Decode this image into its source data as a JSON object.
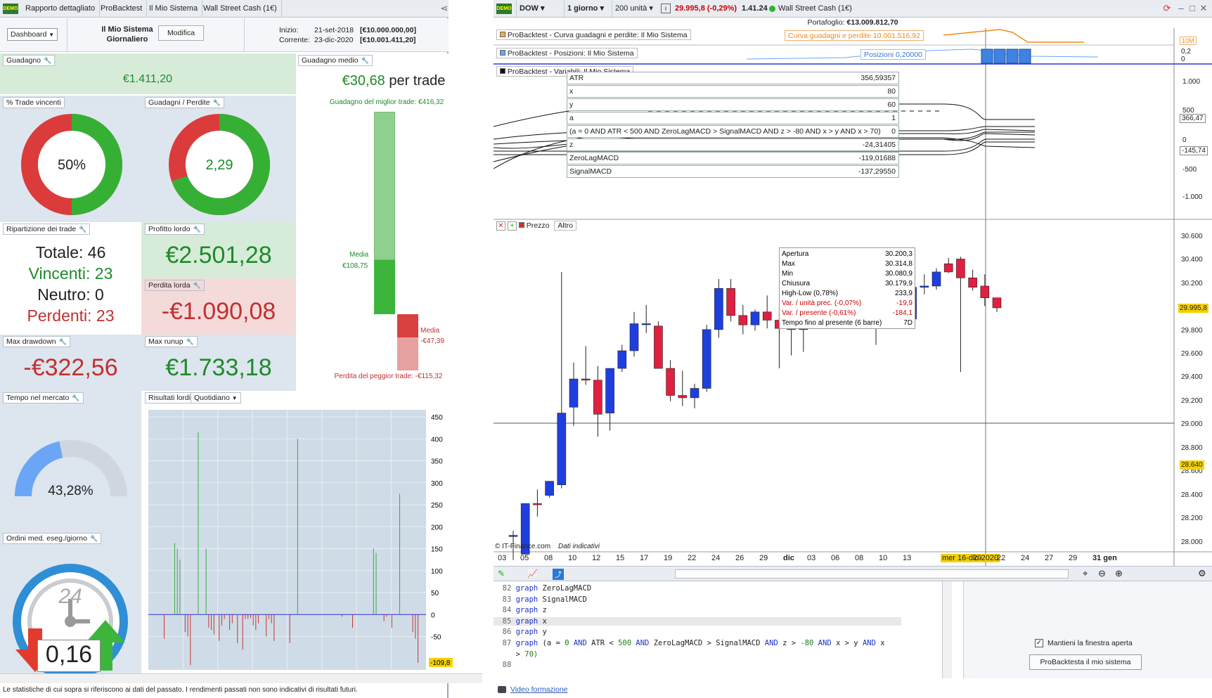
{
  "left": {
    "tabs": [
      "Rapporto dettagliato",
      "ProBacktest",
      "Il Mio Sistema",
      "Wall Street Cash (1€)"
    ],
    "dashboard_label": "Dashboard",
    "system_name": "Il Mio Sistema",
    "system_period": "Giornaliero",
    "modify_label": "Modifica",
    "start_label": "Inizio:",
    "start_date": "21-set-2018",
    "start_value": "[€10.000.000,00]",
    "current_label": "Corrente:",
    "current_date": "23-dic-2020",
    "current_value": "[€10.001.411,20]",
    "gain": {
      "title": "Guadagno",
      "value": "€1.411,20"
    },
    "avg_gain": {
      "title": "Guadagno medio",
      "value": "€30,68",
      "suffix": "per trade",
      "best": "Guadagno del miglior trade: €416,32",
      "worst": "Perdita del peggior trade: -€115,32",
      "media_pos": "Media",
      "media_pos_val": "€108,75",
      "media_neg": "Media",
      "media_neg_val": "-€47,39"
    },
    "win_pct": {
      "title": "% Trade vincenti",
      "value": "50%",
      "fraction": 0.5
    },
    "gain_loss": {
      "title": "Guadagni / Perdite",
      "value": "2,29",
      "fraction": 0.696
    },
    "breakdown": {
      "title": "Ripartizione dei trade",
      "total": "Totale: 46",
      "winners": "Vincenti: 23",
      "neutral": "Neutro: 0",
      "losers": "Perdenti: 23"
    },
    "gross_profit": {
      "title": "Profitto lordo",
      "value": "€2.501,28"
    },
    "gross_loss": {
      "title": "Perdita lorda",
      "value": "-€1.090,08"
    },
    "max_drawdown": {
      "title": "Max drawdown",
      "value": "-€322,56"
    },
    "max_runup": {
      "title": "Max runup",
      "value": "€1.733,18"
    },
    "time_market": {
      "title": "Tempo nel mercato",
      "value": "43,28%",
      "fraction": 0.4328
    },
    "gross_results": {
      "title": "Risultati lordi",
      "period": "Quotidiano"
    },
    "orders": {
      "title": "Ordini med. eseg./giorno",
      "value": "0,16",
      "clock": "24"
    },
    "footer": "Le statistiche di cui sopra si riferiscono ai dati del passato. I rendimenti passati non sono indicativi di risultati futuri."
  },
  "right": {
    "symbol": "DOW",
    "timeframe": "1 giorno",
    "units": "200 unità",
    "price_change": "29.995,8 (-0,29%)",
    "spread": "1.41.24",
    "instrument": "Wall Street Cash (1€)",
    "portfolio_label": "Portafoglio:",
    "portfolio_value": "€13.009.812,70",
    "equity_title": "ProBacktest - Curva guadagni e perdite: Il Mio Sistema",
    "equity_tag": "Curva guadagni e perdite   10.001.516,92",
    "equity_scale": "10M",
    "pos_title": "ProBacktest - Posizioni: Il Mio Sistema",
    "pos_tag": "Posizioni   0,20000",
    "pos_scale_top": "0,2",
    "pos_scale_bot": "0",
    "var_title": "ProBacktest - Variabili: Il Mio Sistema",
    "variables": [
      {
        "name": "ATR",
        "value": "356,59357"
      },
      {
        "name": "x",
        "value": "80"
      },
      {
        "name": "y",
        "value": "60"
      },
      {
        "name": "a",
        "value": "1"
      },
      {
        "name": "(a = 0 AND ATR < 500 AND ZeroLagMACD > SignalMACD AND z > -80 AND x > y AND x > 70)",
        "value": "0"
      },
      {
        "name": "z",
        "value": "-24,31405"
      },
      {
        "name": "ZeroLagMACD",
        "value": "-119,01688"
      },
      {
        "name": "SignalMACD",
        "value": "-137,29550"
      }
    ],
    "var_axis": [
      "1.000",
      "500",
      "0",
      "-500",
      "-1.000"
    ],
    "var_tags": [
      "366,47",
      "-145,74"
    ],
    "price_title": "Prezzo",
    "price_other": "Altro",
    "tooltip": [
      {
        "k": "Apertura",
        "v": "30.200,3",
        "c": "#000"
      },
      {
        "k": "Max",
        "v": "30.314,8",
        "c": "#000"
      },
      {
        "k": "Min",
        "v": "30.080,9",
        "c": "#000"
      },
      {
        "k": "Chiusura",
        "v": "30.179,9",
        "c": "#000"
      },
      {
        "k": "High-Low (0,78%)",
        "v": "233,9",
        "c": "#000"
      },
      {
        "k": "Var. / unità prec. (-0,07%)",
        "v": "-19,9",
        "c": "#c00"
      },
      {
        "k": "Var. / presente (-0,61%)",
        "v": "-184,1",
        "c": "#c00"
      },
      {
        "k": "Tempo fino al presente (6 barre)",
        "v": "7D",
        "c": "#000"
      }
    ],
    "price_axis": [
      "30.600",
      "30.400",
      "30.200",
      "30.000",
      "29.800",
      "29.600",
      "29.400",
      "29.200",
      "29.000",
      "28.800",
      "28.600",
      "28.400",
      "28.200",
      "28.000"
    ],
    "last_price": "29.995,8",
    "cursor_price": "28.640",
    "x_labels": [
      "03",
      "05",
      "08",
      "10",
      "12",
      "15",
      "17",
      "19",
      "22",
      "24",
      "26",
      "29",
      "dic",
      "03",
      "06",
      "08",
      "10",
      "13",
      "mer 16-dic-2020",
      "20",
      "22",
      "24",
      "27",
      "29",
      "31 gen"
    ],
    "copyright": "© IT-Finance.com",
    "indicative": "Dati indicativi",
    "code_lines": [
      {
        "n": "82",
        "t": "graph ZeroLagMACD"
      },
      {
        "n": "83",
        "t": "graph SignalMACD"
      },
      {
        "n": "84",
        "t": "graph z"
      },
      {
        "n": "85",
        "t": "graph x"
      },
      {
        "n": "86",
        "t": "graph y"
      },
      {
        "n": "87",
        "t": "graph (a = 0 AND ATR < 500 AND ZeroLagMACD > SignalMACD AND z > -80 AND x > y AND x"
      },
      {
        "n": "",
        "t": "> 70)"
      },
      {
        "n": "88",
        "t": ""
      }
    ],
    "keep_open": "Mantieni la finestra aperta",
    "run_button": "ProBacktesta il mio sistema",
    "video_link": "Video formazione"
  },
  "chart_data": {
    "type": "bar",
    "title": "Risultati lordi",
    "ylim": [
      -110,
      450
    ],
    "ticks": [
      "450",
      "400",
      "350",
      "300",
      "250",
      "200",
      "150",
      "100",
      "50",
      "0",
      "-50"
    ],
    "last_tag": "-109,8",
    "values": [
      0,
      0,
      0,
      0,
      0,
      -55,
      0,
      0,
      0,
      163,
      150,
      125,
      0,
      -40,
      -50,
      -115,
      0,
      0,
      415,
      0,
      0,
      150,
      -30,
      -35,
      -45,
      0,
      -60,
      -25,
      -10,
      0,
      -35,
      -20,
      0,
      -65,
      0,
      -80,
      -10,
      -10,
      -8,
      -25,
      -35,
      -20,
      0,
      0,
      -50,
      -10,
      -20,
      -60,
      0,
      0,
      0,
      0,
      0,
      -65,
      0,
      0,
      400,
      0,
      0,
      0,
      0,
      0,
      0,
      0,
      0,
      0,
      0,
      0,
      0,
      0,
      0,
      0,
      0,
      -5,
      0,
      0,
      0,
      -30,
      0,
      0,
      0,
      0,
      0,
      0,
      0,
      150,
      140,
      0,
      0,
      -15,
      -5,
      0,
      -30,
      0,
      0,
      275,
      0,
      0,
      0,
      0,
      -40,
      -55,
      -110,
      0
    ]
  },
  "candles": [
    {
      "o": 28050,
      "h": 28100,
      "l": 27850,
      "c": 28060
    },
    {
      "o": 27900,
      "h": 28330,
      "l": 27900,
      "c": 28330
    },
    {
      "o": 28330,
      "h": 28450,
      "l": 28220,
      "c": 28320
    },
    {
      "o": 28400,
      "h": 28520,
      "l": 28380,
      "c": 28520
    },
    {
      "o": 28490,
      "h": 30300,
      "l": 28460,
      "c": 29100
    },
    {
      "o": 29150,
      "h": 29530,
      "l": 28990,
      "c": 29390
    },
    {
      "o": 29390,
      "h": 29670,
      "l": 29340,
      "c": 29380
    },
    {
      "o": 29380,
      "h": 29500,
      "l": 28900,
      "c": 29090
    },
    {
      "o": 29100,
      "h": 29480,
      "l": 28950,
      "c": 29480
    },
    {
      "o": 29480,
      "h": 29680,
      "l": 29450,
      "c": 29630
    },
    {
      "o": 29630,
      "h": 29960,
      "l": 29580,
      "c": 29860
    },
    {
      "o": 29860,
      "h": 30020,
      "l": 29780,
      "c": 29860
    },
    {
      "o": 29840,
      "h": 29880,
      "l": 29540,
      "c": 29480
    },
    {
      "o": 29480,
      "h": 29550,
      "l": 29200,
      "c": 29250
    },
    {
      "o": 29250,
      "h": 29460,
      "l": 29160,
      "c": 29230
    },
    {
      "o": 29230,
      "h": 29350,
      "l": 29140,
      "c": 29310
    },
    {
      "o": 29310,
      "h": 29850,
      "l": 29280,
      "c": 29810
    },
    {
      "o": 29810,
      "h": 30240,
      "l": 29740,
      "c": 30160
    },
    {
      "o": 30160,
      "h": 30240,
      "l": 29880,
      "c": 29930
    },
    {
      "o": 29930,
      "h": 30020,
      "l": 29770,
      "c": 29850
    },
    {
      "o": 29850,
      "h": 29980,
      "l": 29800,
      "c": 29960
    },
    {
      "o": 29960,
      "h": 30100,
      "l": 29820,
      "c": 29890
    },
    {
      "o": 29890,
      "h": 30010,
      "l": 29480,
      "c": 29820
    },
    {
      "o": 29820,
      "h": 29900,
      "l": 29590,
      "c": 29810
    },
    {
      "o": 29810,
      "h": 29960,
      "l": 29620,
      "c": 29890
    },
    {
      "o": 29890,
      "h": 30110,
      "l": 29850,
      "c": 30070
    },
    {
      "o": 30070,
      "h": 30180,
      "l": 29990,
      "c": 30000
    },
    {
      "o": 30000,
      "h": 30200,
      "l": 29980,
      "c": 30150
    },
    {
      "o": 30150,
      "h": 30280,
      "l": 30080,
      "c": 30160
    },
    {
      "o": 30160,
      "h": 30220,
      "l": 30070,
      "c": 30180
    },
    {
      "o": 30200,
      "h": 30230,
      "l": 29680,
      "c": 30050
    },
    {
      "o": 30200,
      "h": 30250,
      "l": 30140,
      "c": 30150
    },
    {
      "o": 30160,
      "h": 30320,
      "l": 29850,
      "c": 29900
    },
    {
      "o": 29900,
      "h": 30180,
      "l": 29860,
      "c": 30170
    },
    {
      "o": 30170,
      "h": 30280,
      "l": 30110,
      "c": 30180
    },
    {
      "o": 30180,
      "h": 30330,
      "l": 30150,
      "c": 30300
    },
    {
      "o": 30370,
      "h": 30420,
      "l": 30290,
      "c": 30300
    },
    {
      "o": 30410,
      "h": 30430,
      "l": 29450,
      "c": 30250
    },
    {
      "o": 30250,
      "h": 30320,
      "l": 30140,
      "c": 30170
    },
    {
      "o": 30180,
      "h": 30280,
      "l": 30010,
      "c": 30080
    },
    {
      "o": 30080,
      "h": 30080,
      "l": 29960,
      "c": 29995
    }
  ]
}
